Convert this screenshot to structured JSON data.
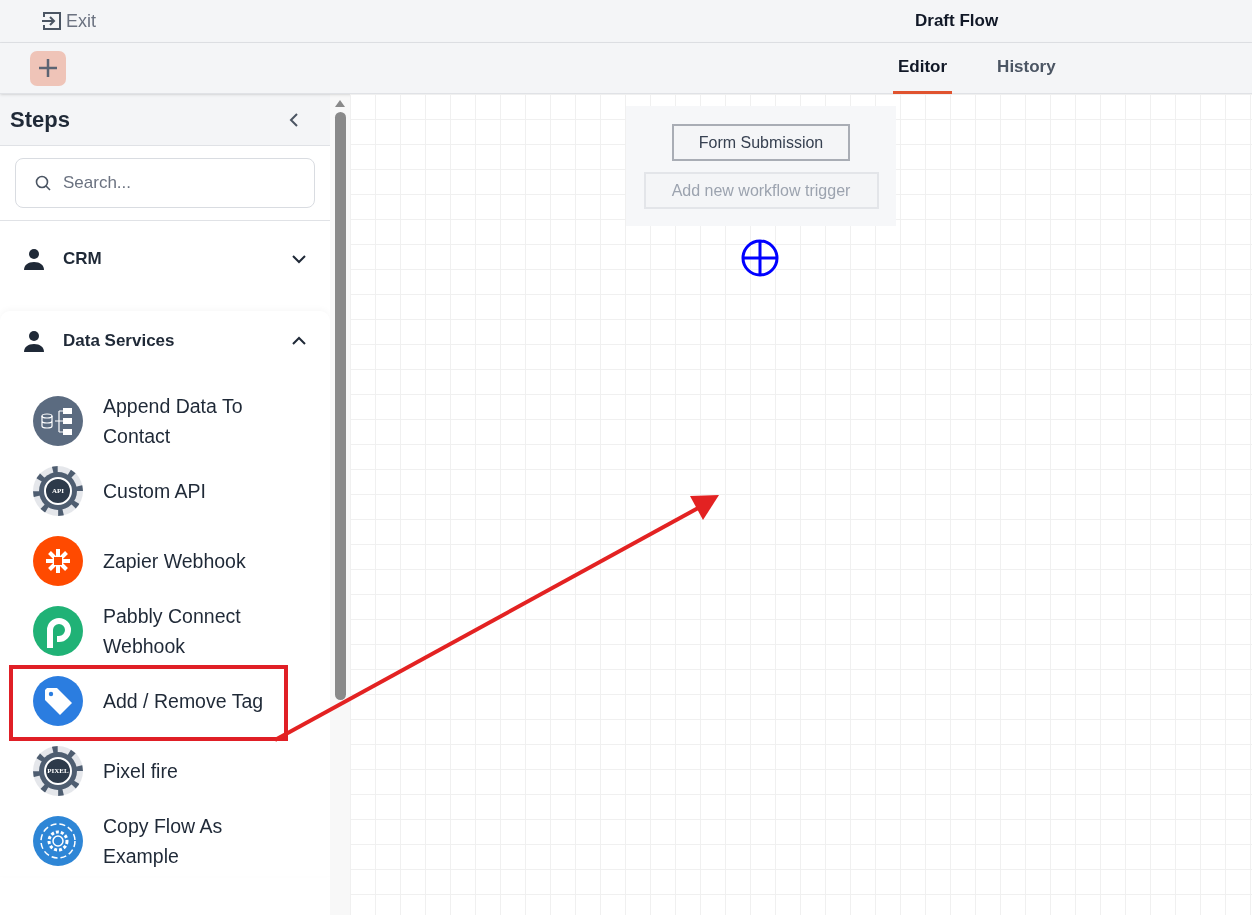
{
  "header": {
    "exit_label": "Exit",
    "title": "Draft Flow"
  },
  "tabs": [
    {
      "label": "Editor",
      "selected": true
    },
    {
      "label": "History",
      "selected": false
    }
  ],
  "sidebar": {
    "title": "Steps",
    "search": {
      "placeholder": "Search..."
    },
    "groups": [
      {
        "label": "CRM",
        "expanded": false
      },
      {
        "label": "Data Services",
        "expanded": true,
        "items": [
          {
            "label": "Append Data To Contact",
            "kind": "database",
            "highlighted": false
          },
          {
            "label": "Custom API",
            "kind": "gear",
            "badge": "API",
            "highlighted": false
          },
          {
            "label": "Zapier Webhook",
            "kind": "zapier",
            "highlighted": false
          },
          {
            "label": "Pabbly Connect Webhook",
            "kind": "pabbly",
            "highlighted": false
          },
          {
            "label": "Add / Remove Tag",
            "kind": "tag",
            "highlighted": true
          },
          {
            "label": "Pixel fire",
            "kind": "gear",
            "badge": "PIXEL",
            "highlighted": false
          },
          {
            "label": "Copy Flow As Example",
            "kind": "cycle",
            "highlighted": false
          }
        ]
      }
    ]
  },
  "canvas": {
    "trigger": {
      "label": "Form Submission"
    },
    "add_trigger": {
      "label": "Add new workflow trigger"
    }
  }
}
